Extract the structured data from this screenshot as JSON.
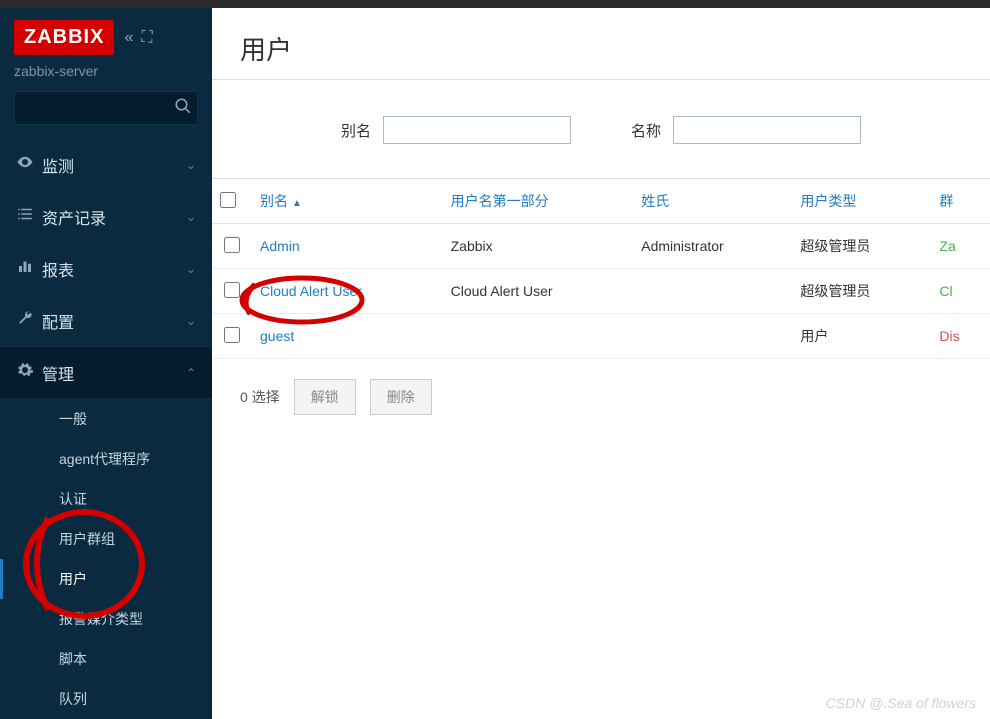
{
  "logo": "ZABBIX",
  "server": "zabbix-server",
  "search_placeholder": "",
  "nav": {
    "monitor": "监测",
    "inventory": "资产记录",
    "reports": "报表",
    "config": "配置",
    "admin": "管理"
  },
  "subnav": {
    "general": "一般",
    "agent": "agent代理程序",
    "auth": "认证",
    "usergroups": "用户群组",
    "users": "用户",
    "mediatypes": "报警媒介类型",
    "scripts": "脚本",
    "queue": "队列"
  },
  "page": {
    "title": "用户"
  },
  "filters": {
    "alias_label": "别名",
    "name_label": "名称",
    "alias_value": "",
    "name_value": ""
  },
  "table": {
    "headers": {
      "check": "",
      "alias": "别名",
      "firstname": "用户名第一部分",
      "lastname": "姓氏",
      "usertype": "用户类型",
      "groups": "群"
    },
    "rows": [
      {
        "alias": "Admin",
        "firstname": "Zabbix",
        "lastname": "Administrator",
        "usertype": "超级管理员",
        "group": "Za",
        "group_color": "green"
      },
      {
        "alias": "Cloud Alert User",
        "firstname": "Cloud Alert User",
        "lastname": "",
        "usertype": "超级管理员",
        "group": "Cl",
        "group_color": "green"
      },
      {
        "alias": "guest",
        "firstname": "",
        "lastname": "",
        "usertype": "用户",
        "group": "Dis",
        "group_color": "red"
      }
    ]
  },
  "footer": {
    "selected": "0 选择",
    "unlock": "解锁",
    "delete": "删除"
  },
  "watermark": "CSDN @.Sea of flowers"
}
